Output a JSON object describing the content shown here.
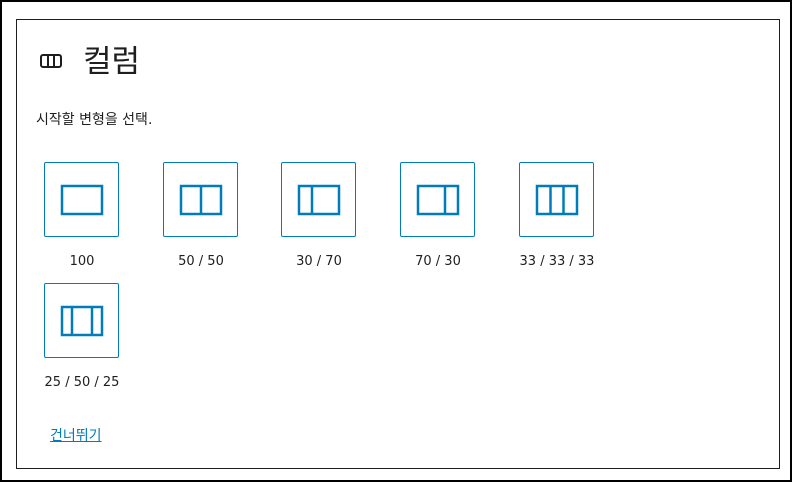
{
  "header": {
    "title": "컬럼",
    "icon": "columns-icon"
  },
  "instructions": "시작할 변형을 선택.",
  "variations": [
    {
      "label": "100",
      "icon": "columns-100-icon"
    },
    {
      "label": "50 / 50",
      "icon": "columns-50-50-icon"
    },
    {
      "label": "30 / 70",
      "icon": "columns-30-70-icon"
    },
    {
      "label": "70 / 30",
      "icon": "columns-70-30-icon"
    },
    {
      "label": "33 / 33 / 33",
      "icon": "columns-33-33-33-icon"
    },
    {
      "label": "25 / 50 / 25",
      "icon": "columns-25-50-25-icon"
    }
  ],
  "skip_label": "건너뛰기",
  "colors": {
    "accent": "#007cba",
    "text": "#1e1e1e",
    "border": "#1e1e1e"
  }
}
